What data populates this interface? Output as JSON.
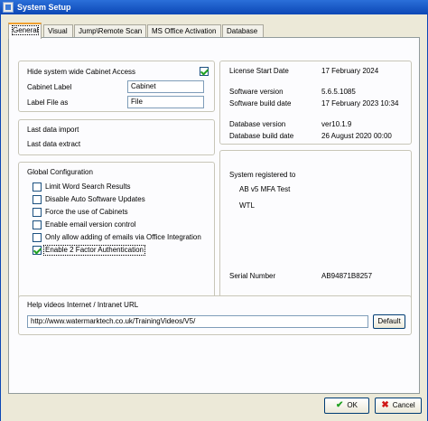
{
  "window": {
    "title": "System Setup"
  },
  "tabs": [
    {
      "label": "General"
    },
    {
      "label": "Visual"
    },
    {
      "label": "Jump\\Remote Scan"
    },
    {
      "label": "MS Office Activation"
    },
    {
      "label": "Database"
    }
  ],
  "cabinet": {
    "hide_access_label": "Hide system wide Cabinet Access",
    "hide_access_checked": true,
    "cabinet_label_label": "Cabinet Label",
    "cabinet_label_value": "Cabinet",
    "label_file_as_label": "Label File as",
    "label_file_as_value": "File"
  },
  "license": {
    "start_date_label": "License Start Date",
    "start_date_value": "17 February 2024",
    "software_version_label": "Software version",
    "software_version_value": "5.6.5.1085",
    "software_build_label": "Software build date",
    "software_build_value": "17 February 2023 10:34",
    "database_version_label": "Database version",
    "database_version_value": "ver10.1.9",
    "database_build_label": "Database build date",
    "database_build_value": "26 August 2020 00:00"
  },
  "data": {
    "last_import_label": "Last data import",
    "last_extract_label": "Last data extract"
  },
  "global_config": {
    "title": "Global Configuration",
    "options": [
      {
        "label": "Limit Word Search Results",
        "checked": false
      },
      {
        "label": "Disable Auto Software Updates",
        "checked": false
      },
      {
        "label": "Force the use of Cabinets",
        "checked": false
      },
      {
        "label": "Enable email version control",
        "checked": false
      },
      {
        "label": "Only allow adding of emails via Office Integration",
        "checked": false
      },
      {
        "label": "Enable 2 Factor Authentication",
        "checked": true
      }
    ]
  },
  "registration": {
    "title": "System registered to",
    "line1": "AB v5 MFA Test",
    "line2": "WTL",
    "serial_label": "Serial Number",
    "serial_value": "AB94871B8257"
  },
  "help": {
    "label": "Help videos Internet / Intranet URL",
    "url_value": "http://www.watermarktech.co.uk/TrainingVideos/V5/",
    "default_label": "Default"
  },
  "footer": {
    "ok_label": "OK",
    "cancel_label": "Cancel",
    "colors": {
      "ok": "#21a121",
      "cancel": "#d01818"
    }
  }
}
